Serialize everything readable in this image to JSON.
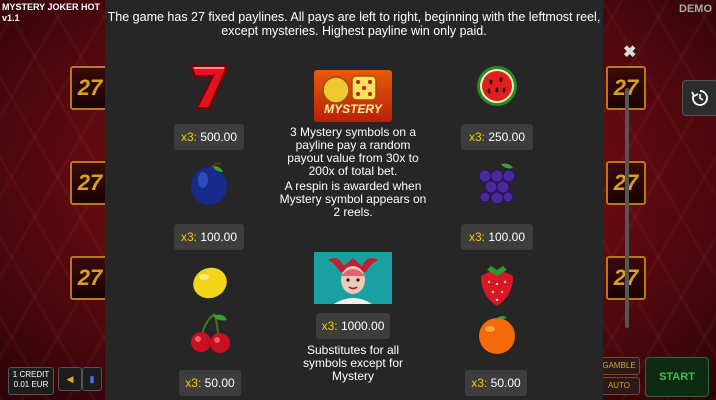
{
  "game": {
    "title": "MYSTERY JOKER HOT",
    "version": "v1.1",
    "mode": "DEMO"
  },
  "reels": {
    "tile_value": "27"
  },
  "controls": {
    "credit_label": "1 CREDIT",
    "credit_value": "0.01 EUR",
    "gamble_label": "GAMBLE",
    "auto_label": "AUTO",
    "start_label": "START"
  },
  "paytable": {
    "intro": "The game has 27 fixed paylines. All pays are left to right, beginning with the leftmost reel, except mysteries. Highest payline win only paid.",
    "close_icon": "✖",
    "mystery": {
      "badge_text": "MYSTERY",
      "desc1": "3 Mystery symbols on a payline pay a random payout value from 30x to 200x of total bet.",
      "desc2": "A respin is awarded when Mystery symbol appears on 2 reels."
    },
    "joker": {
      "mult": "x3:",
      "value": "1000.00",
      "desc": "Substitutes for all symbols except for Mystery"
    },
    "seven": {
      "mult": "x3:",
      "value": "500.00"
    },
    "watermelon": {
      "mult": "x3:",
      "value": "250.00"
    },
    "plum": {
      "mult": "x3:",
      "value": "100.00"
    },
    "grapes": {
      "mult": "x3:",
      "value": "100.00"
    },
    "lemon_cherry": {
      "mult": "x3:",
      "value": "50.00"
    },
    "strawberry_orange": {
      "mult": "x3:",
      "value": "50.00"
    }
  },
  "colors": {
    "multiplier": "#f0d000",
    "panel": "#262626",
    "pay_box": "#3d3d3d"
  }
}
